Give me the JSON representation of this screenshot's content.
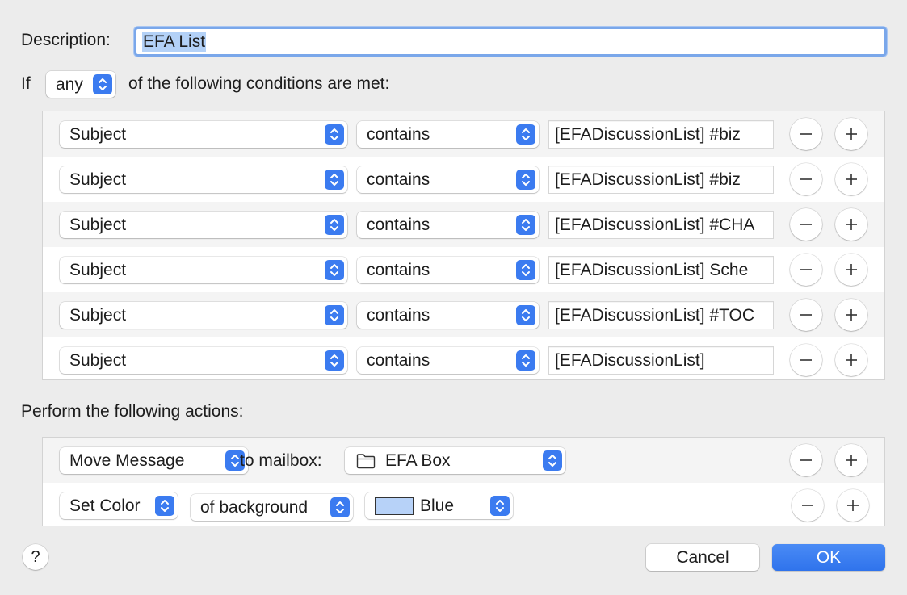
{
  "description": {
    "label": "Description:",
    "value": "EFA List"
  },
  "condition_line": {
    "prefix": "If",
    "match_mode": "any",
    "suffix": "of the following conditions are met:"
  },
  "conditions": [
    {
      "field": "Subject",
      "operator": "contains",
      "value": "[EFADiscussionList] #biz"
    },
    {
      "field": "Subject",
      "operator": "contains",
      "value": "[EFADiscussionList] #biz"
    },
    {
      "field": "Subject",
      "operator": "contains",
      "value": "[EFADiscussionList] #CHA"
    },
    {
      "field": "Subject",
      "operator": "contains",
      "value": "[EFADiscussionList] Sche"
    },
    {
      "field": "Subject",
      "operator": "contains",
      "value": "[EFADiscussionList] #TOC"
    },
    {
      "field": "Subject",
      "operator": "contains",
      "value": "[EFADiscussionList]"
    }
  ],
  "actions_label": "Perform the following actions:",
  "actions": [
    {
      "action": "Move Message",
      "connector": "to mailbox:",
      "mailbox": "EFA Box",
      "mailbox_icon": "folder-icon"
    },
    {
      "action": "Set Color",
      "target": "of background",
      "color_name": "Blue",
      "color_hex": "#b7d2f8"
    }
  ],
  "buttons": {
    "help": "?",
    "cancel": "Cancel",
    "ok": "OK"
  },
  "colors": {
    "accent": "#3b7bf0"
  }
}
